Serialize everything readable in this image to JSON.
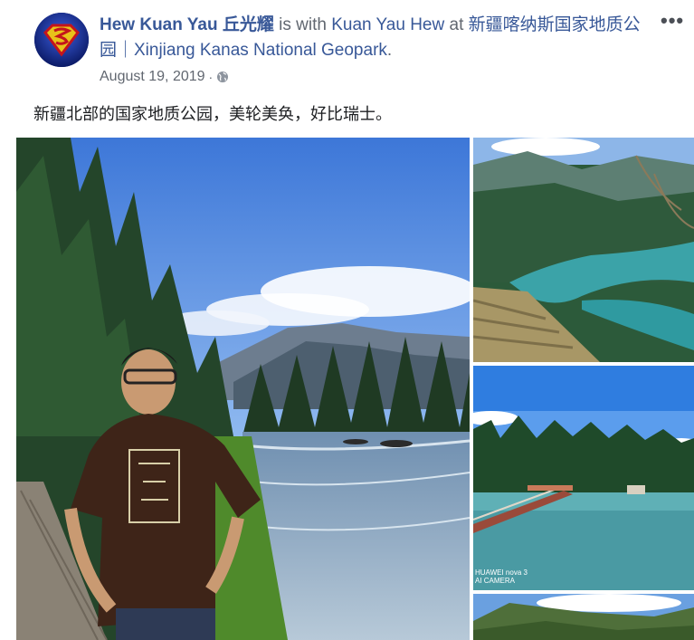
{
  "post": {
    "author": "Hew Kuan Yau 丘光耀",
    "with_text": " is with ",
    "tagged_user": "Kuan Yau Hew",
    "at_text": " at ",
    "place": "新疆喀纳斯国家地质公园｜Xinjiang Kanas National Geopark",
    "period": ".",
    "date": "August 19, 2019",
    "separator": "·",
    "privacy_icon": "globe-icon",
    "more_label": "•••",
    "caption": "新疆北部的国家地质公园，美轮美奂，好比瑞士。"
  },
  "photos": {
    "watermark_line1": "HUAWEI nova 3",
    "watermark_line2": "AI CAMERA"
  },
  "colors": {
    "link": "#385898",
    "meta": "#616770",
    "text": "#1c1e21",
    "avatar_bg": "#172a8a"
  }
}
